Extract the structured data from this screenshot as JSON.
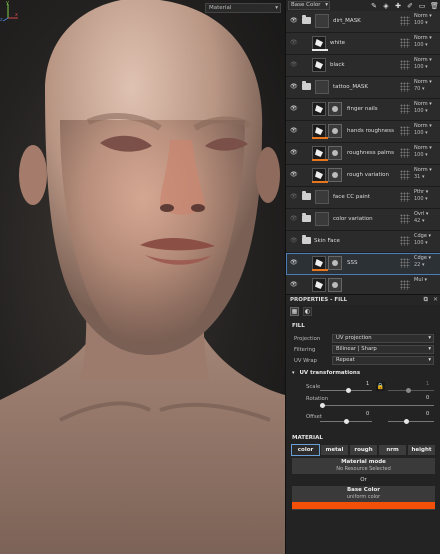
{
  "viewport": {
    "mode_dropdown": "Material"
  },
  "toolbar": {
    "blend_mode": "Base Color"
  },
  "layers": [
    {
      "name": "dirt_MASK",
      "type": "folder",
      "visible": true,
      "blend": "Norm",
      "opacity": "100"
    },
    {
      "name": "white",
      "type": "fill",
      "visible": false,
      "blend": "Norm",
      "opacity": "100",
      "color": "#e8e8e8"
    },
    {
      "name": "black",
      "type": "fill",
      "visible": false,
      "blend": "Norm",
      "opacity": "100",
      "color": ""
    },
    {
      "name": "tattoo_MASK",
      "type": "folder",
      "visible": true,
      "blend": "Norm",
      "opacity": "70"
    },
    {
      "name": "finger nails",
      "type": "fill_mask",
      "visible": true,
      "blend": "Norm",
      "opacity": "100",
      "color": ""
    },
    {
      "name": "hands roughness",
      "type": "fill_mask",
      "visible": true,
      "blend": "Norm",
      "opacity": "100",
      "color": "#e8761c"
    },
    {
      "name": "roughness palms",
      "type": "fill_mask",
      "visible": true,
      "blend": "Norm",
      "opacity": "100",
      "color": "#e8761c"
    },
    {
      "name": "rough variation",
      "type": "fill_mask",
      "visible": true,
      "blend": "Norm",
      "opacity": "31",
      "color": "#e8761c"
    },
    {
      "name": "face CC paint",
      "type": "folder",
      "visible": false,
      "blend": "Pthr",
      "opacity": "100"
    },
    {
      "name": "color variation",
      "type": "folder",
      "visible": false,
      "blend": "Ovrl",
      "opacity": "42"
    },
    {
      "name": "Skin Face",
      "type": "folder_open",
      "visible": false,
      "blend": "Cdge",
      "opacity": "100"
    },
    {
      "name": "SSS",
      "type": "fill_mask",
      "visible": true,
      "selected": true,
      "blend": "Cdge",
      "opacity": "22",
      "color": "#e8761c"
    },
    {
      "name": "",
      "type": "fill_mask",
      "visible": true,
      "blend": "Mul",
      "opacity": "",
      "color": ""
    }
  ],
  "properties": {
    "header": "PROPERTIES - FILL",
    "fill_section": "FILL",
    "projection_label": "Projection",
    "projection_value": "UV projection",
    "filtering_label": "Filtering",
    "filtering_value": "Bilinear | Sharp",
    "uvwrap_label": "UV Wrap",
    "uvwrap_value": "Repeat",
    "uv_transformations": "UV transformations",
    "scale_label": "Scale",
    "scale_a": "1",
    "scale_b": "1",
    "rotation_label": "Rotation",
    "rotation_value": "0",
    "offset_label": "Offset",
    "offset_a": "0",
    "offset_b": "0",
    "material_section": "MATERIAL",
    "channels": [
      "color",
      "metal",
      "rough",
      "nrm",
      "height"
    ],
    "material_mode_title": "Material mode",
    "material_mode_sub": "No Resource Selected",
    "or_text": "Or",
    "base_color_title": "Base Color",
    "base_color_sub": "uniform color",
    "base_color_hex": "#f24f08"
  }
}
